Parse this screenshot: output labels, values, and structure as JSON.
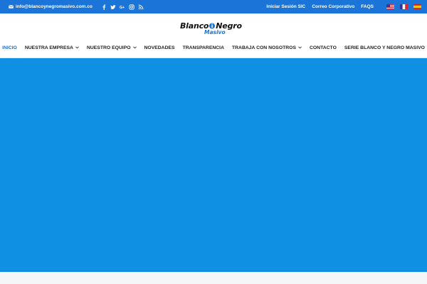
{
  "topbar": {
    "email": "info@blancoynegromasivo.com.co",
    "socials": [
      "facebook-icon",
      "twitter-icon",
      "google-plus-icon",
      "instagram-icon",
      "rss-icon"
    ],
    "links": [
      "Iniciar Sesión SIC",
      "Correo Corporativo",
      "FAQS"
    ],
    "flags": [
      "us-flag-icon",
      "france-flag-icon",
      "spain-flag-icon"
    ]
  },
  "logo": {
    "part1": "Blanco",
    "part2": "Negro",
    "sub": "Masivo"
  },
  "nav": {
    "items": [
      {
        "label": "INICIO",
        "active": true,
        "has_dropdown": false
      },
      {
        "label": "NUESTRA EMPRESA",
        "active": false,
        "has_dropdown": true
      },
      {
        "label": "NUESTRO EQUIPO",
        "active": false,
        "has_dropdown": true
      },
      {
        "label": "NOVEDADES",
        "active": false,
        "has_dropdown": false
      },
      {
        "label": "TRANSPARENCIA",
        "active": false,
        "has_dropdown": false
      },
      {
        "label": "TRABAJA CON NOSOTROS",
        "active": false,
        "has_dropdown": true
      },
      {
        "label": "CONTACTO",
        "active": false,
        "has_dropdown": false
      },
      {
        "label": "SERIE BLANCO Y NEGRO MASIVO",
        "active": false,
        "has_dropdown": false
      }
    ]
  },
  "colors": {
    "topbar": "#1b74d8",
    "hero": "#1090e2",
    "accent": "#1b74d8"
  }
}
